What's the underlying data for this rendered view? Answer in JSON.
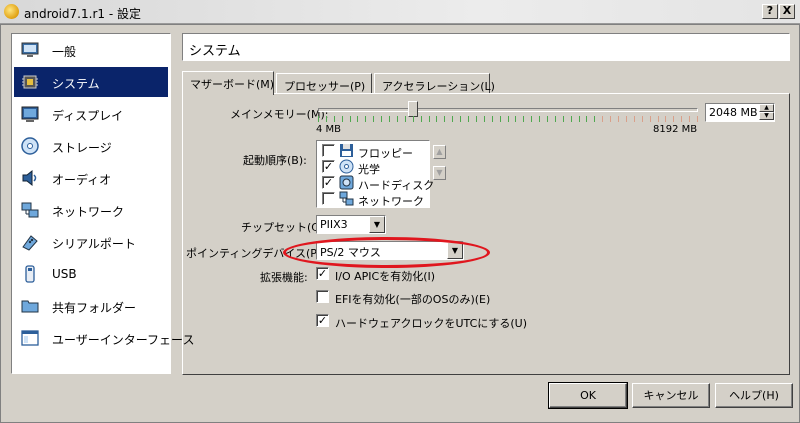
{
  "window": {
    "title": "android7.1.r1 - 設定",
    "help_glyph": "?",
    "close_glyph": "X"
  },
  "sidebar": {
    "items": [
      {
        "label": "一般",
        "icon": "monitor-icon"
      },
      {
        "label": "システム",
        "icon": "chip-icon",
        "selected": true
      },
      {
        "label": "ディスプレイ",
        "icon": "display-icon"
      },
      {
        "label": "ストレージ",
        "icon": "disk-icon"
      },
      {
        "label": "オーディオ",
        "icon": "speaker-icon"
      },
      {
        "label": "ネットワーク",
        "icon": "network-icon"
      },
      {
        "label": "シリアルポート",
        "icon": "serial-port-icon"
      },
      {
        "label": "USB",
        "icon": "usb-icon"
      },
      {
        "label": "共有フォルダー",
        "icon": "folder-icon"
      },
      {
        "label": "ユーザーインターフェース",
        "icon": "window-icon"
      }
    ]
  },
  "header": {
    "title": "システム"
  },
  "tabs": [
    {
      "label": "マザーボード(M)",
      "active": true
    },
    {
      "label": "プロセッサー(P)"
    },
    {
      "label": "アクセラレーション(L)"
    }
  ],
  "motherboard": {
    "memory": {
      "label": "メインメモリー(M):",
      "value": "2048 MB",
      "min_label": "4 MB",
      "max_label": "8192 MB",
      "fraction": 0.25
    },
    "boot_order": {
      "label": "起動順序(B):",
      "items": [
        {
          "label": "フロッピー",
          "checked": false,
          "icon": "floppy-icon"
        },
        {
          "label": "光学",
          "checked": true,
          "icon": "optical-disc-icon"
        },
        {
          "label": "ハードディスク",
          "checked": true,
          "icon": "hard-disk-icon"
        },
        {
          "label": "ネットワーク",
          "checked": false,
          "icon": "network-icon"
        }
      ],
      "up_glyph": "▲",
      "down_glyph": "▼"
    },
    "chipset": {
      "label": "チップセット(C):",
      "value": "PIIX3"
    },
    "pointing_device": {
      "label": "ポインティングデバイス(P):",
      "value": "PS/2 マウス"
    },
    "extended": {
      "label": "拡張機能:",
      "options": [
        {
          "label": "I/O APICを有効化(I)",
          "checked": true
        },
        {
          "label": "EFIを有効化(一部のOSのみ)(E)",
          "checked": false
        },
        {
          "label": "ハードウェアクロックをUTCにする(U)",
          "checked": true
        }
      ]
    }
  },
  "buttons": {
    "ok": "OK",
    "cancel": "キャンセル",
    "help": "ヘルプ(H)"
  },
  "glyphs": {
    "check": "✓",
    "dropdown": "▼",
    "spin_up": "▲",
    "spin_down": "▼"
  },
  "colors": {
    "selection": "#0a246a",
    "annotation": "#e0161e",
    "slider_ok": "#4fa84f",
    "slider_warn": "#d9a08a"
  }
}
